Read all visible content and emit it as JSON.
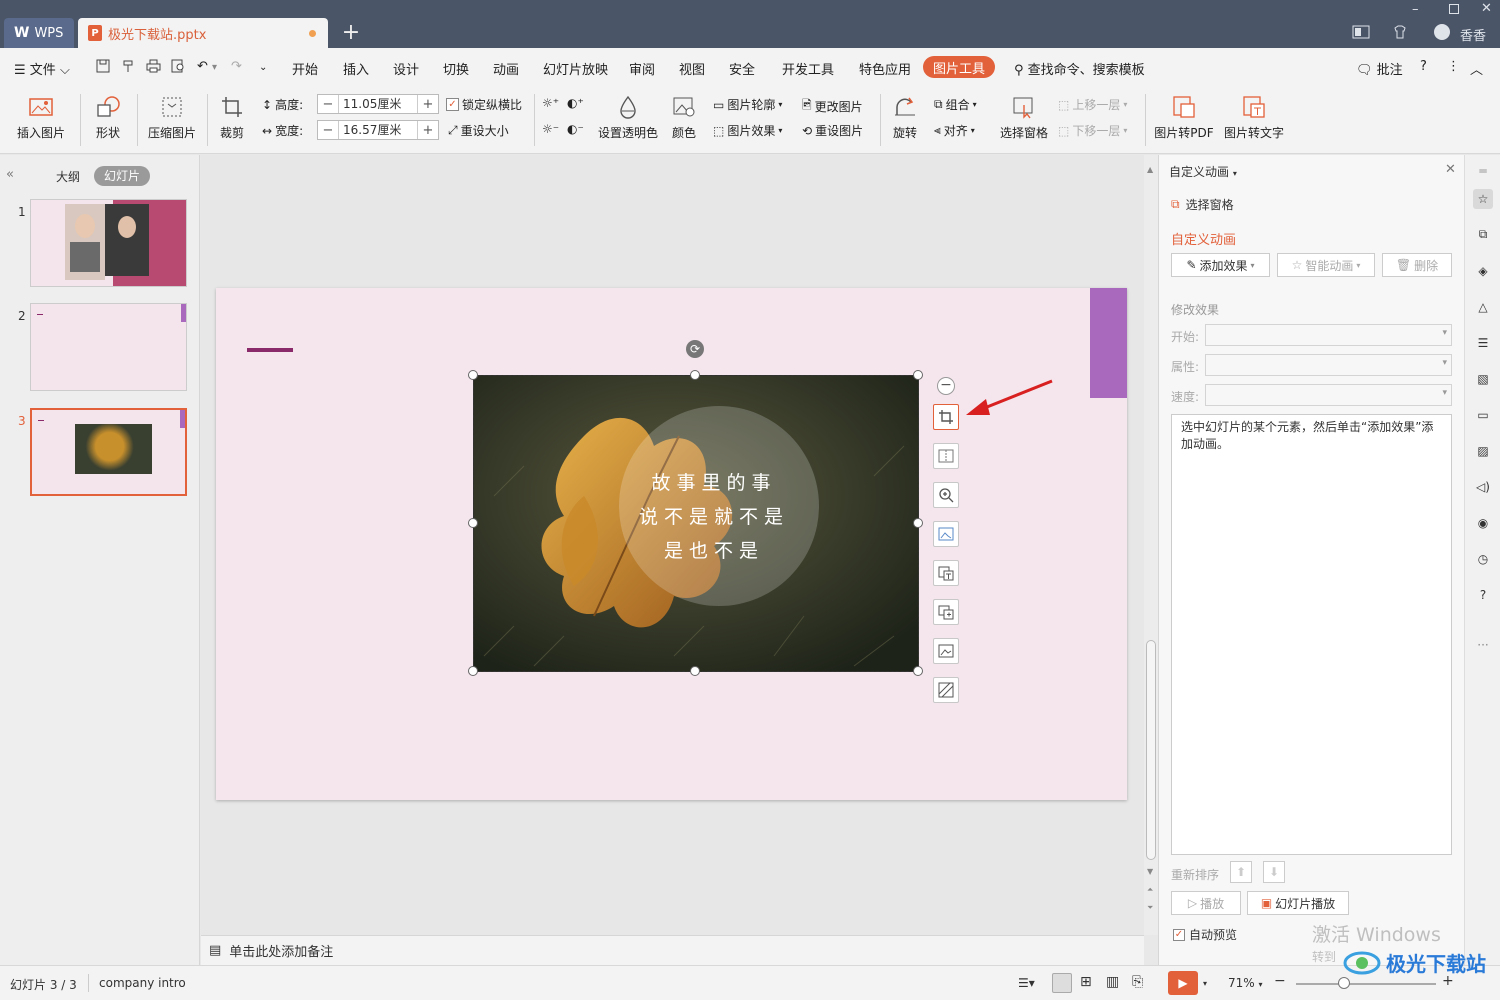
{
  "titlebar": {
    "wps_tab": "WPS",
    "doc_tab": "极光下载站.pptx",
    "new_tab": "+",
    "user": "香香"
  },
  "menu": {
    "file": "文件",
    "items": [
      "开始",
      "插入",
      "设计",
      "切换",
      "动画",
      "幻灯片放映",
      "审阅",
      "视图",
      "安全",
      "开发工具",
      "特色应用"
    ],
    "active_tool": "图片工具",
    "search": "查找命令、搜索模板",
    "comment": "批注",
    "help": "?"
  },
  "ribbon": {
    "insert_picture": "插入图片",
    "shape": "形状",
    "compress": "压缩图片",
    "crop": "裁剪",
    "height_label": "高度:",
    "height_value": "11.05厘米",
    "width_label": "宽度:",
    "width_value": "16.57厘米",
    "lock_ratio": "锁定纵横比",
    "reset_size": "重设大小",
    "transparent": "设置透明色",
    "color": "颜色",
    "outline": "图片轮廓",
    "effect": "图片效果",
    "change_pic": "更改图片",
    "reset_pic": "重设图片",
    "rotate": "旋转",
    "group": "组合",
    "align": "对齐",
    "select_pane": "选择窗格",
    "bring_forward": "上移一层",
    "send_backward": "下移一层",
    "to_pdf": "图片转PDF",
    "to_text": "图片转文字"
  },
  "leftpanel": {
    "tab_outline": "大纲",
    "tab_slides": "幻灯片",
    "slide_numbers": [
      "1",
      "2",
      "3"
    ],
    "active_slide": 3
  },
  "slide": {
    "poem_lines": [
      "故事里的事",
      "说不是就不是",
      "是也不是"
    ]
  },
  "notes": {
    "placeholder": "单击此处添加备注"
  },
  "rightpanel": {
    "title": "自定义动画",
    "select_pane": "选择窗格",
    "section": "自定义动画",
    "add_effect": "添加效果",
    "smart_anim": "智能动画",
    "delete": "删除",
    "modify": "修改效果",
    "start_label": "开始:",
    "prop_label": "属性:",
    "speed_label": "速度:",
    "hint": "选中幻灯片的某个元素，然后单击“添加效果”添加动画。",
    "reorder": "重新排序",
    "play": "播放",
    "slideshow": "幻灯片播放",
    "auto_preview": "自动预览"
  },
  "watermark": {
    "line1": "激活 Windows",
    "line2": "转到",
    "logo": "极光下载站"
  },
  "status": {
    "slide_info": "幻灯片 3 / 3",
    "theme": "company intro",
    "zoom": "71%"
  },
  "colors": {
    "accent": "#e2603a",
    "titlebar": "#4a5568",
    "slide_bg": "#f5e5ed",
    "purple": "#a96abd",
    "arrow": "#d82020"
  }
}
